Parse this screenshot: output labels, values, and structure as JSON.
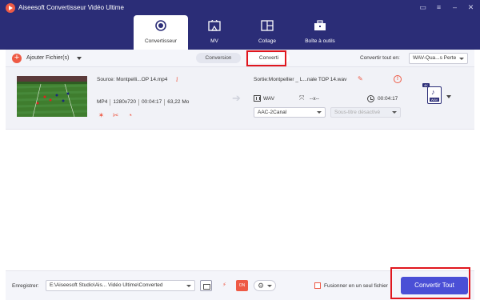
{
  "window": {
    "title": "Aiseesoft Convertisseur Vidéo Ultime",
    "controls": [
      "feedback-icon",
      "menu-icon",
      "minimize-icon",
      "close-icon"
    ]
  },
  "tabs": [
    {
      "label": "Convertisseur",
      "icon": "convert-icon",
      "active": true
    },
    {
      "label": "MV",
      "icon": "mv-icon",
      "active": false
    },
    {
      "label": "Collage",
      "icon": "collage-icon",
      "active": false
    },
    {
      "label": "Boîte à outils",
      "icon": "toolbox-icon",
      "active": false
    }
  ],
  "toolbar": {
    "add_files_label": "Ajouter Fichier(s)",
    "sub_tabs": {
      "conversion": "Conversion",
      "converted": "Converti"
    },
    "convert_all_label": "Convertir tout en:",
    "convert_all_format": "WAV-Qua...s Perte"
  },
  "file": {
    "source_label": "Source: Montpelli...OP 14.mp4",
    "format": "MP4",
    "resolution": "1280x720",
    "duration": "00:04:17",
    "size": "63,22 Mo",
    "output_label": "Sortie:Montpellier _ L...nale TOP 14.wav",
    "output_format": "WAV",
    "output_resolution": "--x--",
    "output_duration": "00:04:17",
    "audio_track": "AAC-2Canal",
    "subtitle": "Sous-titre désactivé",
    "output_icon": {
      "badge": "4K",
      "tag": "WAV"
    }
  },
  "bottom": {
    "save_label": "Enregistrer:",
    "save_path": "E:\\Aiseesoft Studio\\Ais... Vidéo Ultime\\Converted",
    "merge_label": "Fusionner en un seul fichier",
    "convert_all_button": "Convertir Tout"
  },
  "colors": {
    "header": "#2b2d77",
    "accent": "#ee5a45",
    "primary_button": "#4a4fd6",
    "highlight": "#e0171e"
  }
}
